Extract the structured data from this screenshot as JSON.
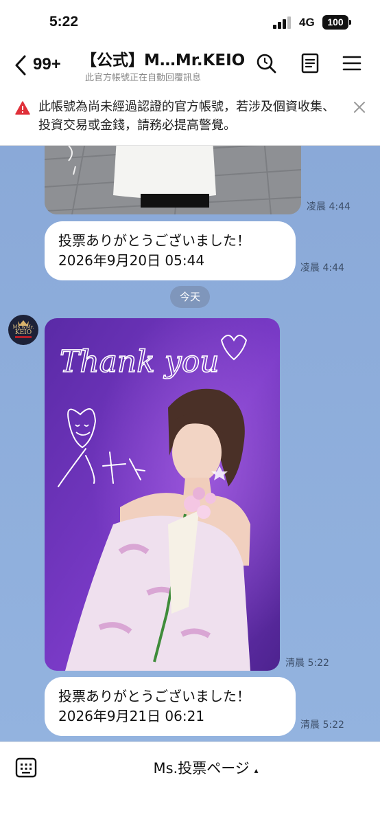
{
  "status_bar": {
    "time": "5:22",
    "network": "4G",
    "battery": "100"
  },
  "header": {
    "unread_count": "99+",
    "title": "【公式】M…Mr.KEIO",
    "subtitle": "此官方帳號正在自動回覆訊息",
    "icons": [
      "search-icon",
      "notes-icon",
      "menu-icon"
    ]
  },
  "warning": {
    "text": "此帳號為尚未經過認證的官方帳號，若涉及個資收集、投資交易或金錢，請務必提高警覺。"
  },
  "messages": [
    {
      "type": "image",
      "time": "凌晨 4:44"
    },
    {
      "type": "text",
      "lines": [
        "投票ありがとうございました！",
        "2026年9月20日 05:44"
      ],
      "time": "凌晨 4:44"
    },
    {
      "type": "date",
      "label": "今天"
    },
    {
      "type": "image",
      "overlay_text": "Thank you",
      "signature": "YUKA",
      "time": "清晨 5:22"
    },
    {
      "type": "text",
      "lines": [
        "投票ありがとうございました！",
        "2026年9月21日 06:21"
      ],
      "time": "清晨 5:22"
    }
  ],
  "avatar_text": [
    "Ms.&Mr.",
    "KEIO"
  ],
  "bottom_bar": {
    "menu_label": "Ms.投票ページ",
    "menu_arrow": "▴"
  },
  "colors": {
    "chat_bg": "#8aa9d8",
    "warning": "#e0313a",
    "photo_bg": "#6a2fb4"
  }
}
